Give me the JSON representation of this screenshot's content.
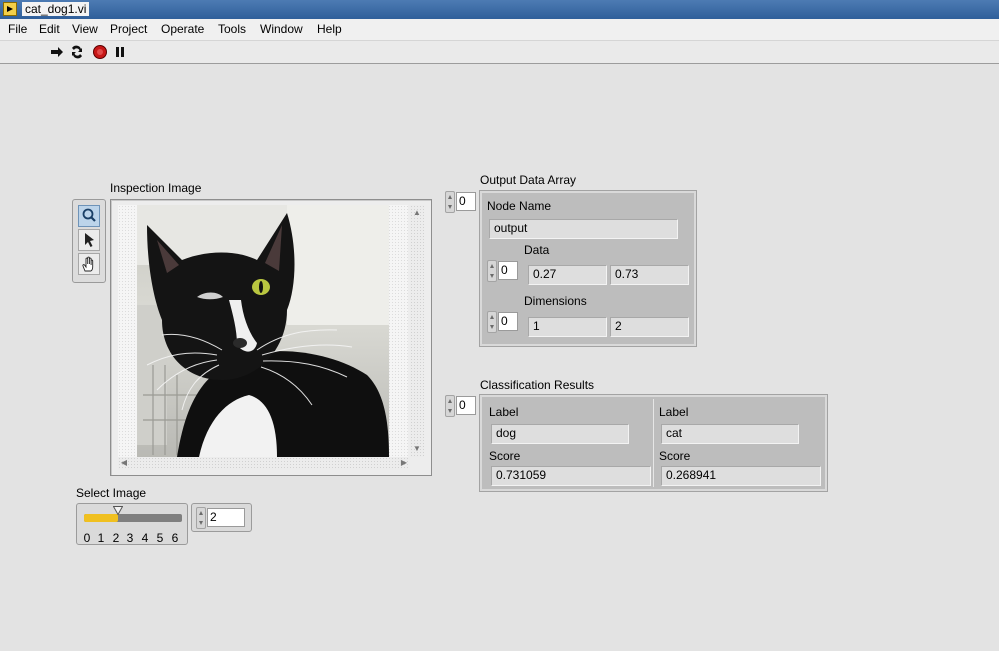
{
  "window": {
    "title": "cat_dog1.vi"
  },
  "menu": [
    "File",
    "Edit",
    "View",
    "Project",
    "Operate",
    "Tools",
    "Window",
    "Help"
  ],
  "toolbar": [
    "run-arrow-icon",
    "run-continuously-icon",
    "abort-icon",
    "pause-icon"
  ],
  "image_display": {
    "label": "Inspection Image",
    "tools": [
      "zoom-icon",
      "pointer-icon",
      "pan-hand-icon"
    ],
    "photo": "black-and-white cat"
  },
  "output_array": {
    "label": "Output Data Array",
    "index": "0",
    "node_name_label": "Node Name",
    "node_name_value": "output",
    "data_label": "Data",
    "data_index": "0",
    "data_values": [
      "0.27",
      "0.73"
    ],
    "dims_label": "Dimensions",
    "dims_index": "0",
    "dims_values": [
      "1",
      "2"
    ]
  },
  "classification": {
    "label": "Classification Results",
    "index": "0",
    "items": [
      {
        "label_caption": "Label",
        "label_value": "dog",
        "score_caption": "Score",
        "score_value": "0.731059"
      },
      {
        "label_caption": "Label",
        "label_value": "cat",
        "score_caption": "Score",
        "score_value": "0.268941"
      }
    ]
  },
  "select_image": {
    "label": "Select Image",
    "ticks": [
      "0",
      "1",
      "2",
      "3",
      "4",
      "5",
      "6"
    ],
    "value": "2",
    "slider_value": 2,
    "slider_max": 6,
    "accent_color": "#f0c020"
  }
}
